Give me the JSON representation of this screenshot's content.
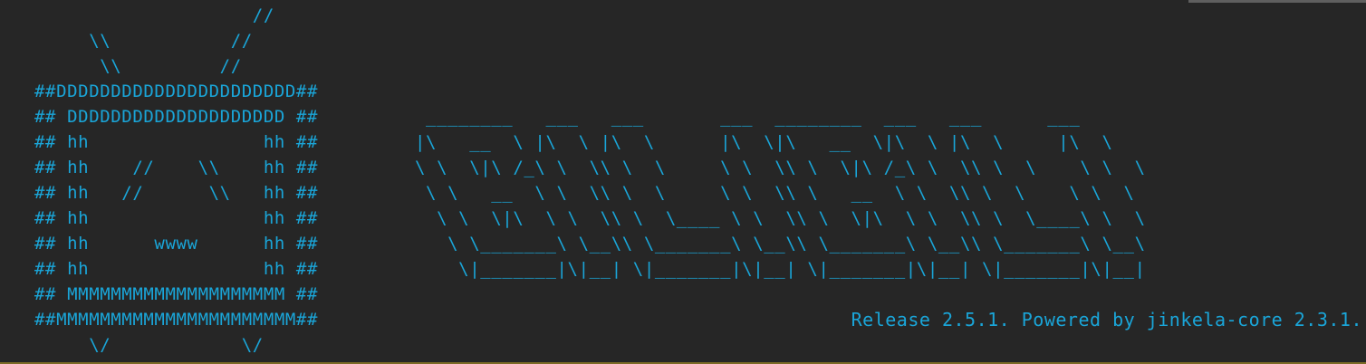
{
  "tv_art": "                    //\n     \\\\           //\n      \\\\         //\n##DDDDDDDDDDDDDDDDDDDDDD##\n## DDDDDDDDDDDDDDDDDDDD ##\n## hh                hh ##\n## hh    //    \\\\    hh ##\n## hh   //      \\\\   hh ##\n## hh                hh ##\n## hh      wwww      hh ##\n## hh                hh ##\n## MMMMMMMMMMMMMMMMMMMM ##\n##MMMMMMMMMMMMMMMMMMMMMM##\n     \\/            \\/",
  "logo_art": " ________   ___   ___       ___  ________  ___   ___      ___\n|\\   __  \\ |\\  \\ |\\  \\      |\\  \\|\\   __  \\|\\  \\ |\\  \\     |\\  \\\n\\ \\  \\|\\ /_\\ \\  \\\\ \\  \\     \\ \\  \\\\ \\  \\|\\ /_\\ \\  \\\\ \\  \\    \\ \\  \\\n \\ \\   __  \\ \\  \\\\ \\  \\     \\ \\  \\\\ \\   __  \\ \\  \\\\ \\  \\    \\ \\  \\\n  \\ \\  \\|\\  \\ \\  \\\\ \\  \\____ \\ \\  \\\\ \\  \\|\\  \\ \\  \\\\ \\  \\____\\ \\  \\\n   \\ \\_______\\ \\__\\\\ \\_______\\ \\__\\\\ \\_______\\ \\__\\\\ \\_______\\ \\__\\\n    \\|_______|\\|__| \\|_______|\\|__| \\|_______|\\|__| \\|_______|\\|__|",
  "release_text": "Release 2.5.1. Powered by jinkela-core 2.3.1.",
  "colors": {
    "background": "#262626",
    "text": "#1aa5d8",
    "top_rule": "#5f5f5f",
    "bottom_rule": "#7c6b26"
  }
}
